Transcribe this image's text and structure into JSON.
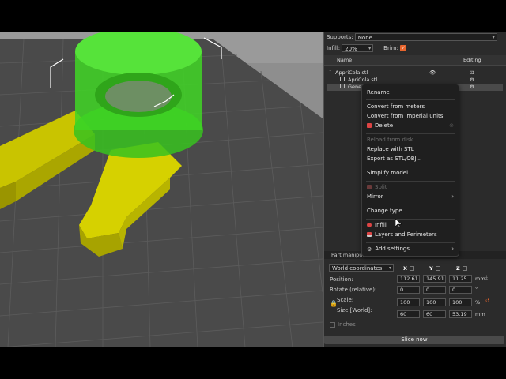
{
  "top_panel": {
    "supports_label": "Supports:",
    "supports_value": "None",
    "infill_label": "Infill:",
    "infill_value": "20%",
    "brim_label": "Brim:",
    "brim_checked": true
  },
  "object_list": {
    "columns": {
      "name": "Name",
      "editing": "Editing"
    },
    "rows": [
      {
        "label": "AppriCola.stl",
        "level": 0
      },
      {
        "label": "ApriCola.stl",
        "level": 1
      },
      {
        "label": "Gene",
        "level": 1,
        "selected": true
      }
    ]
  },
  "context_menu": {
    "rename": "Rename",
    "convert_meters": "Convert from meters",
    "convert_imperial": "Convert from imperial units",
    "delete": "Delete",
    "reload_disk": "Reload from disk",
    "replace_stl": "Replace with STL",
    "export": "Export as STL/OBJ...",
    "simplify": "Simplify model",
    "split": "Split",
    "mirror": "Mirror",
    "change_type": "Change type",
    "infill": "Infill",
    "layers_perimeters": "Layers and Perimeters",
    "add_settings": "Add settings"
  },
  "part_manipulation": {
    "title": "Part manipulation",
    "coords_value": "World coordinates",
    "axes": {
      "x": "X",
      "y": "Y",
      "z": "Z"
    },
    "position_label": "Position:",
    "position": [
      "112.61",
      "145.91",
      "11.25"
    ],
    "position_unit": "mm",
    "rotate_label": "Rotate (relative):",
    "rotate": [
      "0",
      "0",
      "0"
    ],
    "rotate_unit": "°",
    "scale_label": "Scale:",
    "scale": [
      "100",
      "100",
      "100"
    ],
    "scale_unit": "%",
    "size_label": "Size [World]:",
    "size": [
      "60",
      "60",
      "53.19"
    ],
    "size_unit": "mm",
    "inches_label": "Inches"
  },
  "slice_button": "Slice now",
  "colors": {
    "accent": "#e8652d",
    "model_yellow": "#d4d000",
    "model_green": "#33d11a",
    "bed": "#8e8e8e"
  }
}
